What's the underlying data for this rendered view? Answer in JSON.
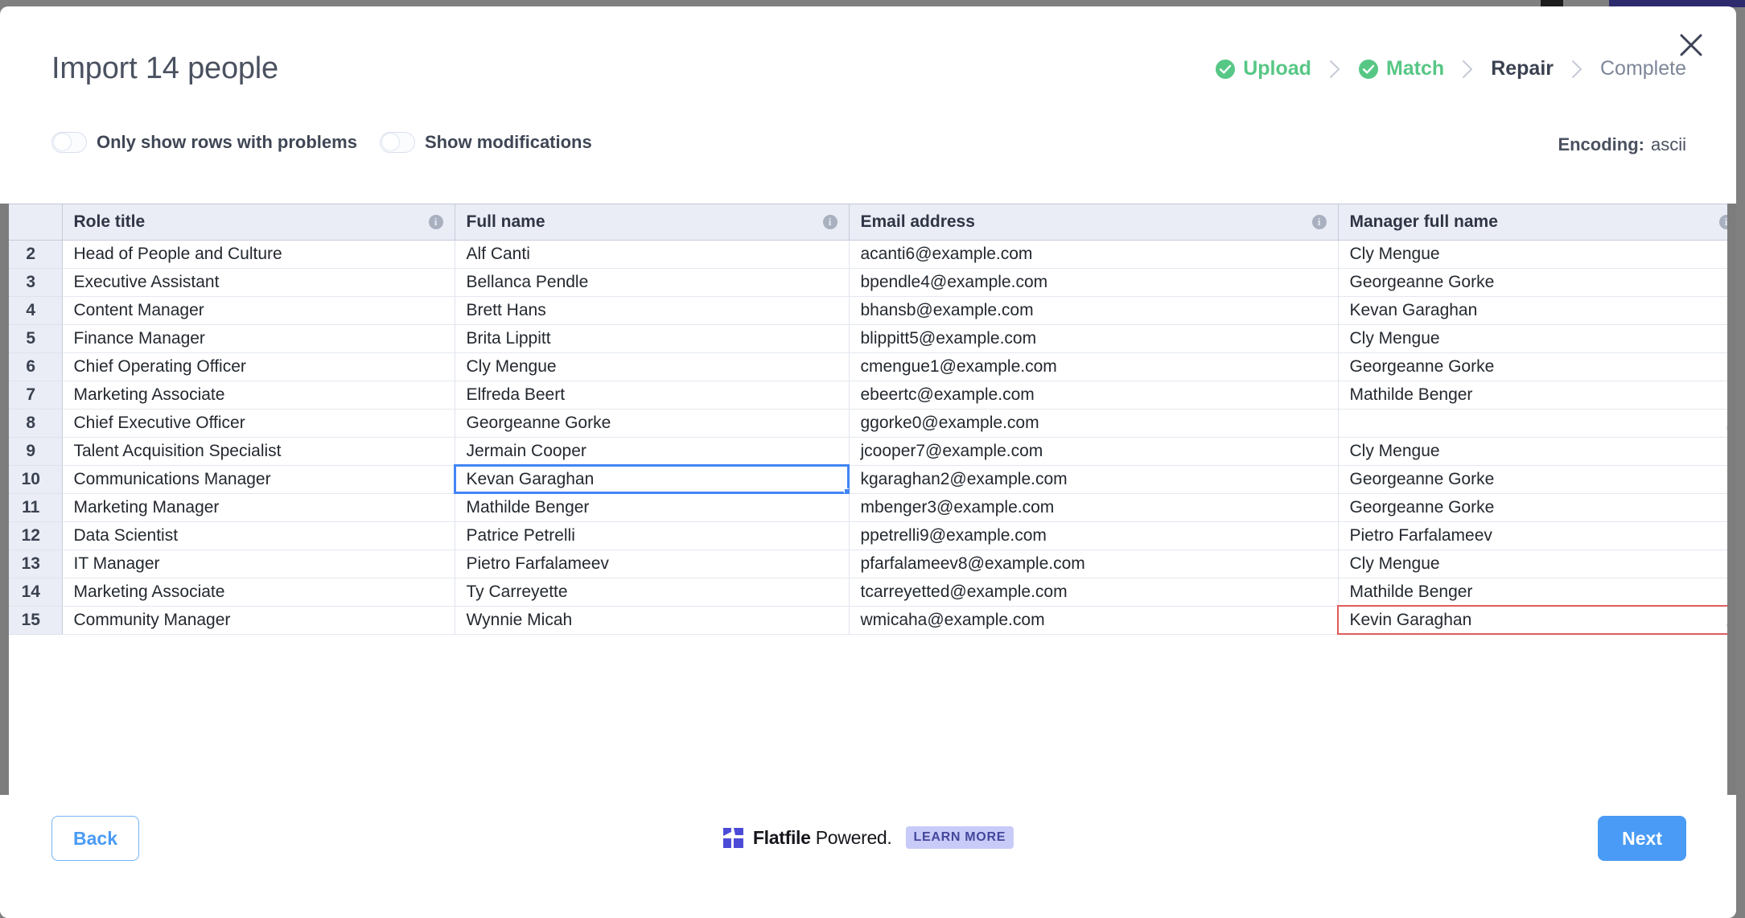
{
  "header": {
    "title": "Import 14 people",
    "close_label": "×"
  },
  "stepper": {
    "separator": "›",
    "steps": [
      {
        "label": "Upload",
        "state": "done"
      },
      {
        "label": "Match",
        "state": "done"
      },
      {
        "label": "Repair",
        "state": "active"
      },
      {
        "label": "Complete",
        "state": "todo"
      }
    ]
  },
  "controls": {
    "toggles": [
      {
        "label": "Only show rows with problems",
        "on": false
      },
      {
        "label": "Show modifications",
        "on": false
      }
    ],
    "encoding_label": "Encoding:",
    "encoding_value": "ascii"
  },
  "grid": {
    "info_glyph": "i",
    "columns": [
      {
        "label": "Role title",
        "has_info": true
      },
      {
        "label": "Full name",
        "has_info": true
      },
      {
        "label": "Email address",
        "has_info": true
      },
      {
        "label": "Manager full name",
        "has_info": true
      }
    ],
    "rows": [
      {
        "n": "2",
        "cells": [
          "Head of People and Culture",
          "Alf Canti",
          "acanti6@example.com",
          "Cly Mengue"
        ]
      },
      {
        "n": "3",
        "cells": [
          "Executive Assistant",
          "Bellanca Pendle",
          "bpendle4@example.com",
          "Georgeanne Gorke"
        ]
      },
      {
        "n": "4",
        "cells": [
          "Content Manager",
          "Brett Hans",
          "bhansb@example.com",
          "Kevan Garaghan"
        ]
      },
      {
        "n": "5",
        "cells": [
          "Finance Manager",
          "Brita Lippitt",
          "blippitt5@example.com",
          "Cly Mengue"
        ]
      },
      {
        "n": "6",
        "cells": [
          "Chief Operating Officer",
          "Cly Mengue",
          "cmengue1@example.com",
          "Georgeanne Gorke"
        ]
      },
      {
        "n": "7",
        "cells": [
          "Marketing Associate",
          "Elfreda Beert",
          "ebeertc@example.com",
          "Mathilde Benger"
        ]
      },
      {
        "n": "8",
        "cells": [
          "Chief Executive Officer",
          "Georgeanne Gorke",
          "ggorke0@example.com",
          ""
        ]
      },
      {
        "n": "9",
        "cells": [
          "Talent Acquisition Specialist",
          "Jermain Cooper",
          "jcooper7@example.com",
          "Cly Mengue"
        ]
      },
      {
        "n": "10",
        "cells": [
          "Communications Manager",
          "Kevan Garaghan",
          "kgaraghan2@example.com",
          "Georgeanne Gorke"
        ]
      },
      {
        "n": "11",
        "cells": [
          "Marketing Manager",
          "Mathilde Benger",
          "mbenger3@example.com",
          "Georgeanne Gorke"
        ]
      },
      {
        "n": "12",
        "cells": [
          "Data Scientist",
          "Patrice Petrelli",
          "ppetrelli9@example.com",
          "Pietro Farfalameev"
        ]
      },
      {
        "n": "13",
        "cells": [
          "IT Manager",
          "Pietro Farfalameev",
          "pfarfalameev8@example.com",
          "Cly Mengue"
        ]
      },
      {
        "n": "14",
        "cells": [
          "Marketing Associate",
          "Ty Carreyette",
          "tcarreyetted@example.com",
          "Mathilde Benger"
        ]
      },
      {
        "n": "15",
        "cells": [
          "Community Manager",
          "Wynnie Micah",
          "wmicaha@example.com",
          "Kevin Garaghan"
        ]
      }
    ],
    "selected_cell": {
      "row": 8,
      "col": 1
    },
    "error_cells": [
      {
        "row": 13,
        "col": 3
      }
    ],
    "pencil_cells": [
      {
        "row": 6,
        "col": 3
      },
      {
        "row": 13,
        "col": 3
      }
    ]
  },
  "footer": {
    "back_label": "Back",
    "next_label": "Next",
    "brand_name": "Flatfile",
    "brand_suffix": " Powered.",
    "learn_more_label": "LEARN MORE"
  },
  "colors": {
    "accent_blue": "#4a9bf5",
    "selection_blue": "#4285f4",
    "success_green": "#57c785",
    "error_red": "#d03232",
    "error_bg": "#fbe1e1",
    "header_bg": "#eaedf6",
    "brand_indigo": "#4b4bd8"
  }
}
